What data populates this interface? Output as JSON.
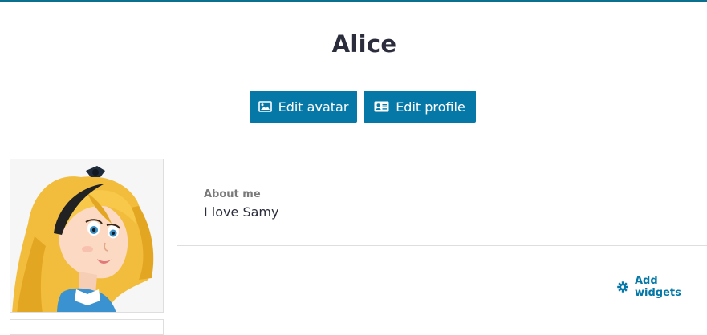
{
  "profile": {
    "name": "Alice"
  },
  "actions": {
    "edit_avatar": "Edit avatar",
    "edit_profile": "Edit profile"
  },
  "about": {
    "label": "About me",
    "text": "I love Samy"
  },
  "widgets": {
    "add_label": "Add widgets"
  },
  "icons": {
    "edit_avatar": "image-icon",
    "edit_profile": "id-card-icon",
    "add_widgets": "gear-icon"
  },
  "colors": {
    "accent": "#0578a7",
    "top_border": "#0b6f8f",
    "title": "#2b2d3c",
    "muted_label": "#7a7a7a",
    "card_border": "#dedede"
  }
}
